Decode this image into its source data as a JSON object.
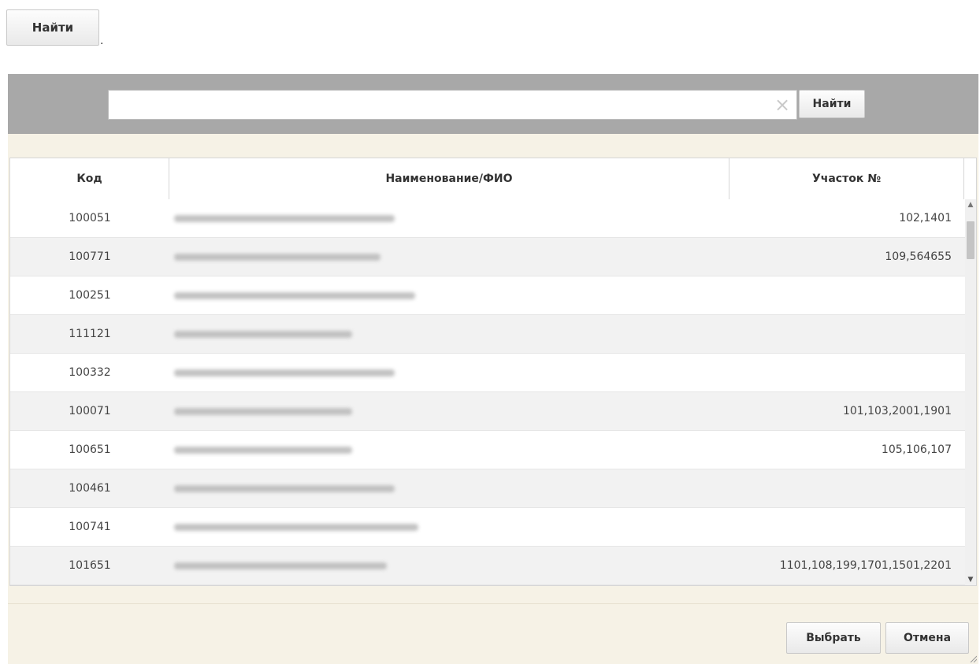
{
  "top": {
    "find_label": "Найти",
    "dot": "."
  },
  "search": {
    "value": "",
    "placeholder": "",
    "clear_icon": "×",
    "find_label": "Найти"
  },
  "grid": {
    "columns": {
      "code": "Код",
      "name": "Наименование/ФИО",
      "uchastok": "Участок №"
    },
    "rows": [
      {
        "code": "100051",
        "uchastok": "102,1401"
      },
      {
        "code": "100771",
        "uchastok": "109,564655"
      },
      {
        "code": "100251",
        "uchastok": ""
      },
      {
        "code": "111121",
        "uchastok": ""
      },
      {
        "code": "100332",
        "uchastok": ""
      },
      {
        "code": "100071",
        "uchastok": "101,103,2001,1901"
      },
      {
        "code": "100651",
        "uchastok": "105,106,107"
      },
      {
        "code": "100461",
        "uchastok": ""
      },
      {
        "code": "100741",
        "uchastok": ""
      },
      {
        "code": "101651",
        "uchastok": "1101,108,199,1701,1501,2201"
      }
    ],
    "scroll_up_icon": "▲",
    "scroll_down_icon": "▼"
  },
  "footer": {
    "select_label": "Выбрать",
    "cancel_label": "Отмена"
  },
  "colors": {
    "search_bar": "#a8a8a8",
    "dialog_bg": "#f6f2e6",
    "row_alt": "#f2f2f2"
  }
}
